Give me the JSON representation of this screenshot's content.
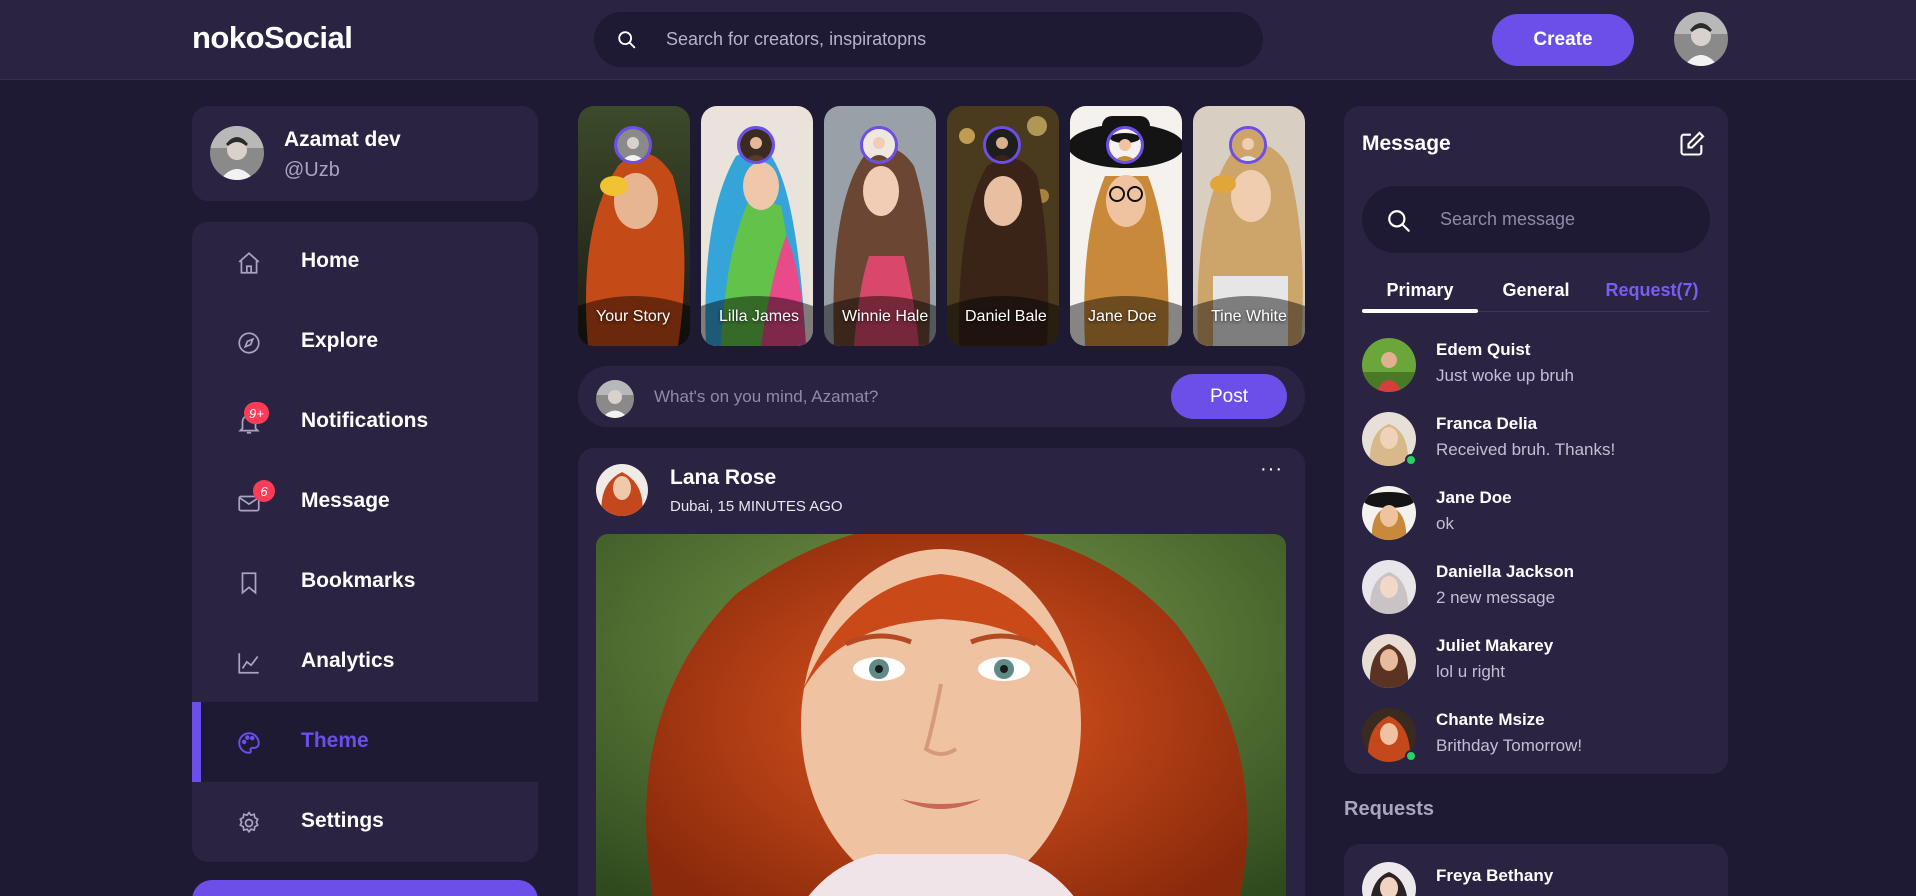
{
  "header": {
    "logo": "nokoSocial",
    "search_placeholder": "Search for creators, inspiratopns",
    "create_label": "Create"
  },
  "profile": {
    "name": "Azamat dev",
    "handle": "@Uzb"
  },
  "sidebar": {
    "items": [
      {
        "label": "Home",
        "icon": "home-icon"
      },
      {
        "label": "Explore",
        "icon": "compass-icon"
      },
      {
        "label": "Notifications",
        "icon": "bell-icon",
        "badge": "9+"
      },
      {
        "label": "Message",
        "icon": "envelope-icon",
        "badge": "6"
      },
      {
        "label": "Bookmarks",
        "icon": "bookmark-icon"
      },
      {
        "label": "Analytics",
        "icon": "chart-icon"
      },
      {
        "label": "Theme",
        "icon": "palette-icon",
        "active": true
      },
      {
        "label": "Settings",
        "icon": "gear-icon"
      }
    ]
  },
  "stories": [
    {
      "name": "Your Story"
    },
    {
      "name": "Lilla James"
    },
    {
      "name": "Winnie Hale"
    },
    {
      "name": "Daniel Bale"
    },
    {
      "name": "Jane Doe"
    },
    {
      "name": "Tine White"
    }
  ],
  "composer": {
    "placeholder": "What's on you mind, Azamat?",
    "post_label": "Post"
  },
  "feed": {
    "author": "Lana Rose",
    "meta": "Dubai, 15 MINUTES AGO",
    "more": "···"
  },
  "messages": {
    "title": "Message",
    "search_placeholder": "Search message",
    "tabs": [
      "Primary",
      "General",
      "Request(7)"
    ],
    "chats": [
      {
        "name": "Edem Quist",
        "text": "Just woke up bruh",
        "online": false
      },
      {
        "name": "Franca Delia",
        "text": "Received bruh. Thanks!",
        "online": true
      },
      {
        "name": "Jane Doe",
        "text": "ok",
        "online": false
      },
      {
        "name": "Daniella Jackson",
        "text": "2 new message",
        "online": false
      },
      {
        "name": "Juliet Makarey",
        "text": "lol u right",
        "online": false
      },
      {
        "name": "Chante Msize",
        "text": "Brithday Tomorrow!",
        "online": true
      }
    ]
  },
  "requests": {
    "title": "Requests",
    "first_name": "Freya Bethany"
  },
  "colors": {
    "background": "#1f1a33",
    "card": "#2a2442",
    "accent": "#6c4ee8",
    "badge": "#ff3b57",
    "online": "#25d366"
  }
}
